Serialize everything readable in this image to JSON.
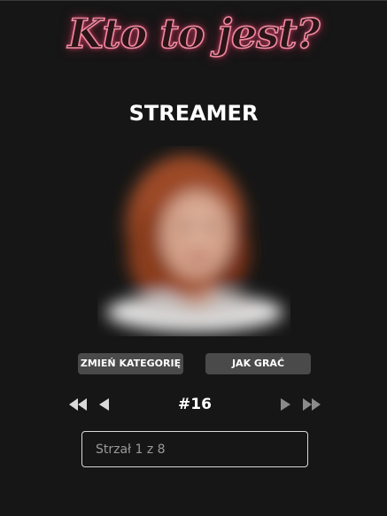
{
  "header": {
    "logo_text": "Kto to jest?"
  },
  "puzzle": {
    "category": "STREAMER",
    "number_label": "#16"
  },
  "buttons": {
    "change_category": "ZMIEŃ KATEGORIĘ",
    "how_to_play": "JAK GRAĆ"
  },
  "navigation": {
    "first_icon": "double-chevron-left-icon",
    "prev_icon": "triangle-left-icon",
    "next_icon": "triangle-right-icon",
    "last_icon": "double-chevron-right-icon"
  },
  "guess": {
    "placeholder": "Strzał 1 z 8",
    "value": ""
  },
  "colors": {
    "background": "#161616",
    "logo_glow": "#f05078",
    "button_bg": "#4a4a4a",
    "nav_active": "#d9d9d9",
    "nav_inactive": "#8a8a8a"
  }
}
